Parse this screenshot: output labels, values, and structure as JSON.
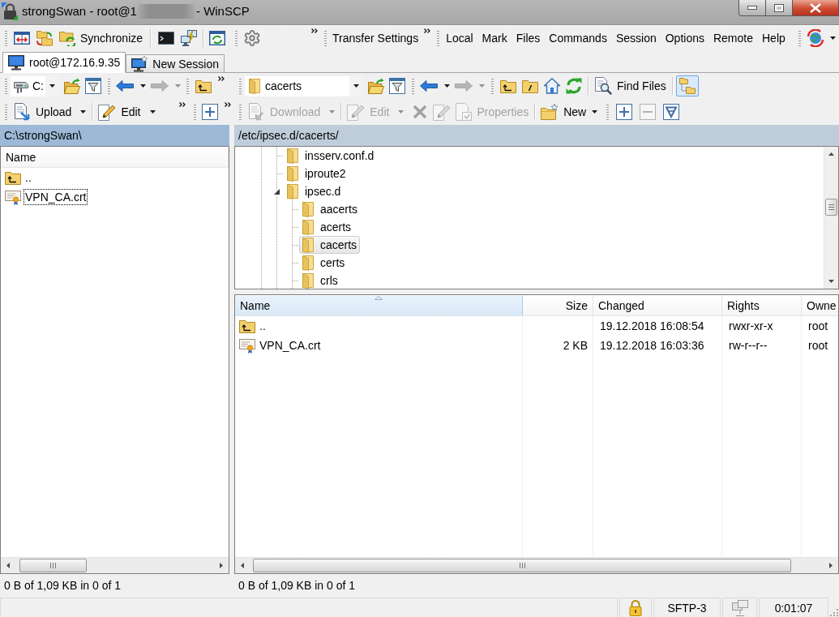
{
  "window": {
    "title_start": "strongSwan - root@1",
    "title_end": "- WinSCP"
  },
  "main_toolbar": {
    "synchronize": "Synchronize",
    "transfer_settings": "Transfer Settings"
  },
  "menu": [
    "Local",
    "Mark",
    "Files",
    "Commands",
    "Session",
    "Options",
    "Remote",
    "Help"
  ],
  "tabs": [
    {
      "label": "root@172.16.9.35",
      "kind": "session",
      "selected": true
    },
    {
      "label": "New Session",
      "kind": "new_session",
      "selected": false
    }
  ],
  "left_panel": {
    "active": true,
    "address_toolbar": {
      "drive": "C:",
      "forward": {
        "disabled": true
      }
    },
    "file_toolbar": {
      "upload": {
        "label": "Upload",
        "disabled": false
      },
      "edit": {
        "label": "Edit",
        "disabled": false
      }
    },
    "path": "C:\\strongSwan\\",
    "file_list": {
      "columns": [
        {
          "label": "Name",
          "sorted": false
        }
      ],
      "rows": [
        {
          "kind": "parent",
          "name": "..",
          "selected": false,
          "focused": false
        },
        {
          "kind": "certificate",
          "name": "VPN_CA.crt",
          "selected": false,
          "focused": true
        }
      ]
    },
    "status": "0 B of 1,09 KB in 0 of 1"
  },
  "right_panel": {
    "active": false,
    "address_toolbar": {
      "folder": "cacerts",
      "forward": {
        "disabled": true
      },
      "find_files": {
        "label": "Find Files"
      },
      "tree_toggle": {
        "pressed": true
      }
    },
    "file_toolbar": {
      "download": {
        "label": "Download",
        "disabled": true
      },
      "edit": {
        "label": "Edit",
        "disabled": true
      },
      "delete": {
        "disabled": true
      },
      "rename": {
        "disabled": true
      },
      "properties": {
        "label": "Properties",
        "disabled": true
      },
      "new": {
        "label": "New",
        "disabled": false
      },
      "minus": {
        "disabled": true
      }
    },
    "path": "/etc/ipsec.d/cacerts/",
    "tree": [
      {
        "label": "insserv.conf.d",
        "selected": false,
        "expanded": false
      },
      {
        "label": "iproute2",
        "selected": false,
        "expanded": false
      },
      {
        "label": "ipsec.d",
        "selected": false,
        "expanded": true,
        "children": [
          {
            "label": "aacerts",
            "selected": false,
            "expanded": false
          },
          {
            "label": "acerts",
            "selected": false,
            "expanded": false
          },
          {
            "label": "cacerts",
            "selected": true,
            "expanded": false
          },
          {
            "label": "certs",
            "selected": false,
            "expanded": false
          },
          {
            "label": "crls",
            "selected": false,
            "expanded": false
          }
        ]
      }
    ],
    "file_list": {
      "columns": [
        {
          "label": "Name",
          "sorted": true
        },
        {
          "label": "Size",
          "sorted": false
        },
        {
          "label": "Changed",
          "sorted": false
        },
        {
          "label": "Rights",
          "sorted": false
        },
        {
          "label": "Owne",
          "sorted": false
        }
      ],
      "rows": [
        {
          "kind": "parent",
          "name": "..",
          "changed": "19.12.2018 16:08:54",
          "rights": "rwxr-xr-x",
          "column_5": "root",
          "selected": false,
          "focused": false
        },
        {
          "kind": "certificate",
          "name": "VPN_CA.crt",
          "size": "2 KB",
          "changed": "19.12.2018 16:03:36",
          "rights": "rw-r--r--",
          "column_5": "root",
          "selected": false,
          "focused": false
        }
      ]
    },
    "status": "0 B of 1,09 KB in 0 of 1"
  },
  "status_bar": {
    "protocol": "SFTP-3",
    "elapsed": "0:01:07"
  }
}
